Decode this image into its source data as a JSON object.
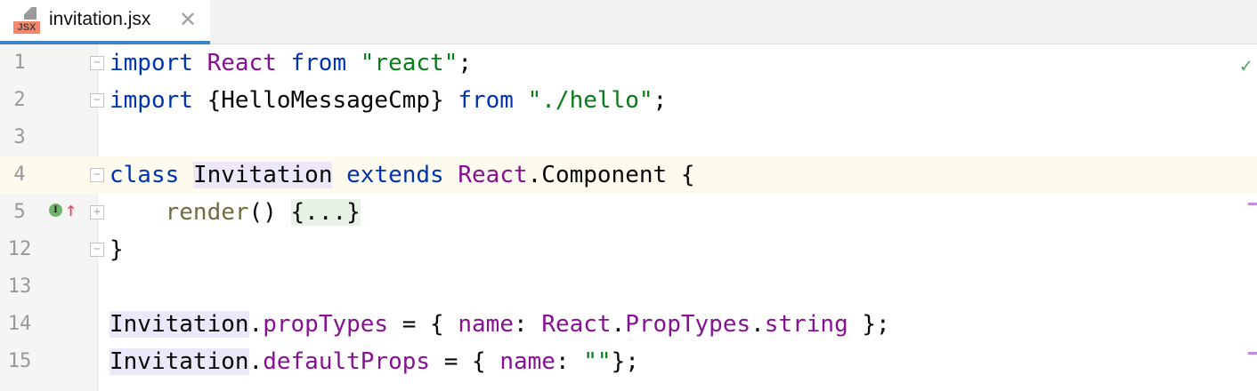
{
  "tab": {
    "label": "invitation.jsx",
    "icon_label": "JSX",
    "close": "✕"
  },
  "status": {
    "check": "✓"
  },
  "gutter": {
    "badge": "I",
    "arrow": "↑"
  },
  "lines": [
    {
      "n": "1",
      "t": [
        [
          "kw",
          "import"
        ],
        [
          "",
          ""
        ],
        [
          "cls",
          " React"
        ],
        [
          "kw",
          " from"
        ],
        [
          "str",
          " \"react\""
        ],
        [
          "",
          ";"
        ]
      ]
    },
    {
      "n": "2",
      "t": [
        [
          "kw",
          "import"
        ],
        [
          "",
          " {HelloMessageCmp}"
        ],
        [
          "kw",
          " from"
        ],
        [
          "str",
          " \"./hello\""
        ],
        [
          "",
          ";"
        ]
      ]
    },
    {
      "n": "3",
      "t": []
    },
    {
      "n": "4",
      "t": [
        [
          "kw",
          "class"
        ],
        [
          "",
          " "
        ],
        [
          "caret",
          ""
        ],
        [
          "hl",
          "Invitation"
        ],
        [
          "kw",
          " extends"
        ],
        [
          "cls",
          " React"
        ],
        [
          "",
          ".Component {"
        ]
      ]
    },
    {
      "n": "5",
      "t": [
        [
          "",
          "    "
        ],
        [
          "fn",
          "render"
        ],
        [
          "",
          "() "
        ],
        [
          "fld",
          "{...}"
        ]
      ]
    },
    {
      "n": "12",
      "t": [
        [
          "",
          "}"
        ]
      ]
    },
    {
      "n": "13",
      "t": []
    },
    {
      "n": "14",
      "t": [
        [
          "hl",
          "Invitation"
        ],
        [
          "",
          ". "
        ],
        [
          "cls",
          "propTypes"
        ],
        [
          "",
          " = { "
        ],
        [
          "cls",
          "name"
        ],
        [
          "",
          ": "
        ],
        [
          "cls",
          "React"
        ],
        [
          "",
          "."
        ],
        [
          "cls",
          "PropTypes"
        ],
        [
          "",
          "."
        ],
        [
          "cls",
          "string"
        ],
        [
          "",
          " };"
        ]
      ]
    },
    {
      "n": "15",
      "t": [
        [
          "hl",
          "Invitation"
        ],
        [
          "",
          "."
        ],
        [
          "cls",
          "defaultProps"
        ],
        [
          "",
          " = { "
        ],
        [
          "cls",
          "name"
        ],
        [
          "",
          ": "
        ],
        [
          "str",
          "\"\""
        ],
        [
          "",
          "};"
        ]
      ]
    }
  ]
}
